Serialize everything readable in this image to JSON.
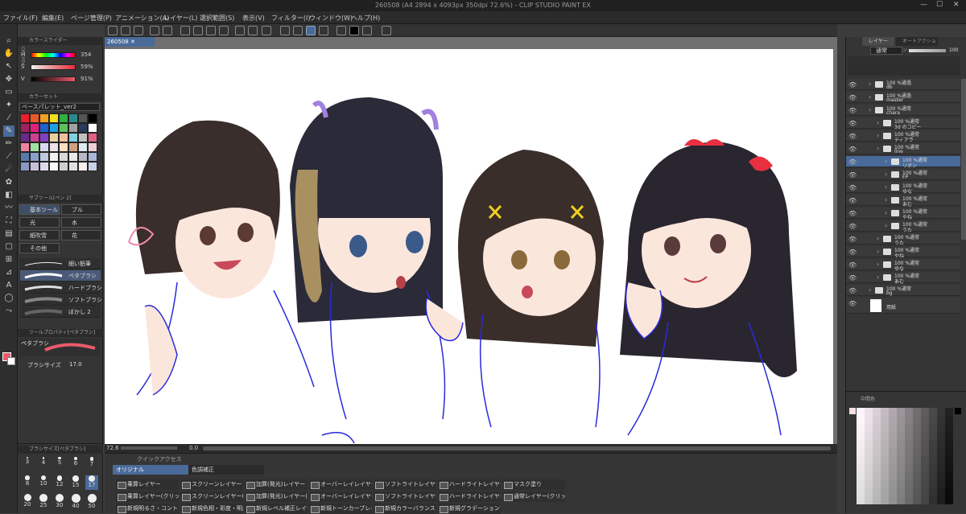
{
  "app": {
    "title": "260508 (A4 2894 x 4093px 350dpi 72.6%) - CLIP STUDIO PAINT EX"
  },
  "menu": [
    "ファイル(F)",
    "編集(E)",
    "ページ管理(P)",
    "アニメーション(A)",
    "レイヤー(L)",
    "選択範囲(S)",
    "表示(V)",
    "フィルター(I)",
    "ウィンドウ(W)",
    "ヘルプ(H)"
  ],
  "document_tab": "260508",
  "color_slider": {
    "header": "カラースライダー",
    "side_tabs": "CMY HSV",
    "h_label": "H",
    "h_value": "354",
    "s_label": "S",
    "s_value": "59%",
    "v_label": "V",
    "v_value": "91%"
  },
  "color_set": {
    "header": "カラーセット",
    "palette": "ベースパレット_ver2",
    "swatches": [
      "#e8202a",
      "#e85a2a",
      "#f0a020",
      "#f0e020",
      "#30b040",
      "#2a8a8a",
      "#555555",
      "#000000",
      "#a02060",
      "#e02080",
      "#2060d0",
      "#20a0e0",
      "#60c060",
      "#a0a0a0",
      "#2a3a5a",
      "#ffffff",
      "#6a2a8a",
      "#d04090",
      "#8040c0",
      "#e8d0a0",
      "#f0c0a0",
      "#80d0e0",
      "#c0c0c0",
      "#e06080",
      "#f080a0",
      "#a0e0a0",
      "#d8d8f0",
      "#f0e0e8",
      "#ffe0c0",
      "#d0a080",
      "#e0e8f0",
      "#f0d0d8",
      "#5a7aaa",
      "#8aa0c8",
      "#c0c8e0",
      "#f0f0f0",
      "#d8d8d8",
      "#e8e8e8",
      "#b8b8c8",
      "#a8b8d8",
      "#8898c0",
      "#c8c0d8",
      "#e0d8e8",
      "#f8f8f8",
      "#d0d0d0",
      "#e0e0e0",
      "#f8f0f0",
      "#c8d0e8"
    ]
  },
  "sub_tool": {
    "header": "サブツール[ペン 2]",
    "groups": [
      "基本ツール",
      "ブル",
      "光",
      "水",
      "紙吹雪",
      "花",
      "その他"
    ],
    "brushes": [
      "細い鉛筆",
      "ペタブラシ",
      "ハードブラシ",
      "ソフトブラシ",
      "ぼかし 2"
    ]
  },
  "tool_property": {
    "header": "ツールプロパティ[ペタブラシ]",
    "brush_name": "ペタブラシ",
    "size_label": "ブラシサイズ",
    "size_value": "17.0"
  },
  "brush_size": {
    "header": "ブラシサイズ[ペタブラシ]",
    "sizes": [
      "3",
      "4",
      "5",
      "6",
      "7",
      "8",
      "10",
      "12",
      "15",
      "17",
      "20",
      "25",
      "30",
      "40",
      "50"
    ]
  },
  "status": {
    "zoom": "72.6",
    "angle": "0.0"
  },
  "quick_access": {
    "header": "クイックアクセス",
    "tabs": [
      "オリジナル",
      "色調補正"
    ],
    "rows": [
      [
        "乗算レイヤー",
        "スクリーンレイヤー",
        "加算(発光)レイヤー",
        "オーバーレイレイヤー",
        "ソフトライトレイヤー",
        "ハードライトレイヤー",
        "マスク塗り"
      ],
      [
        "乗算レイヤー(クリッピング)",
        "スクリーンレイヤー(クリッピング)",
        "加算(発光)レイヤー(クリッピング)",
        "オーバーレイレイヤー(クリッピング)",
        "ソフトライトレイヤー(クリッピング)",
        "ハードライトレイヤー(クリッピング)",
        "通常レイヤー(クリッピング)"
      ],
      [
        "新規明るさ・コントラスト",
        "新規色相・彩度・明度",
        "新規レベル補正レイヤー",
        "新規トーンカーブレイヤー",
        "新規カラーバランスレイヤー",
        "新規グラデーションマップ"
      ]
    ]
  },
  "layer_panel": {
    "tabs": [
      "レイヤー",
      "オートアクション"
    ],
    "blend": "通常",
    "opacity": "100",
    "layers": [
      {
        "pct": "100 %通過",
        "name": "db",
        "indent": 0
      },
      {
        "pct": "100 %通過",
        "name": "master",
        "indent": 0
      },
      {
        "pct": "100 %通常",
        "name": "chara",
        "indent": 0
      },
      {
        "pct": "100 %通常",
        "name": "3d のコピー",
        "indent": 1
      },
      {
        "pct": "100 %通常",
        "name": "ティアラ",
        "indent": 1
      },
      {
        "pct": "100 %通常",
        "name": "line",
        "indent": 1
      },
      {
        "pct": "100 %通常",
        "name": "リボン",
        "indent": 2
      },
      {
        "pct": "100 %通常",
        "name": "FP",
        "indent": 2
      },
      {
        "pct": "100 %通常",
        "name": "ゆな",
        "indent": 2
      },
      {
        "pct": "100 %通常",
        "name": "あむ",
        "indent": 2
      },
      {
        "pct": "100 %通常",
        "name": "やね",
        "indent": 2
      },
      {
        "pct": "100 %通常",
        "name": "うた",
        "indent": 2
      },
      {
        "pct": "100 %通常",
        "name": "うた",
        "indent": 1
      },
      {
        "pct": "100 %通常",
        "name": "やね",
        "indent": 1
      },
      {
        "pct": "100 %通常",
        "name": "ゆな",
        "indent": 1
      },
      {
        "pct": "100 %通常",
        "name": "あむ",
        "indent": 1
      },
      {
        "pct": "100 %通常",
        "name": "bg",
        "indent": 0
      },
      {
        "pct": "",
        "name": "用紙",
        "indent": 0
      }
    ]
  },
  "color_panel": {
    "header": "中間色"
  }
}
